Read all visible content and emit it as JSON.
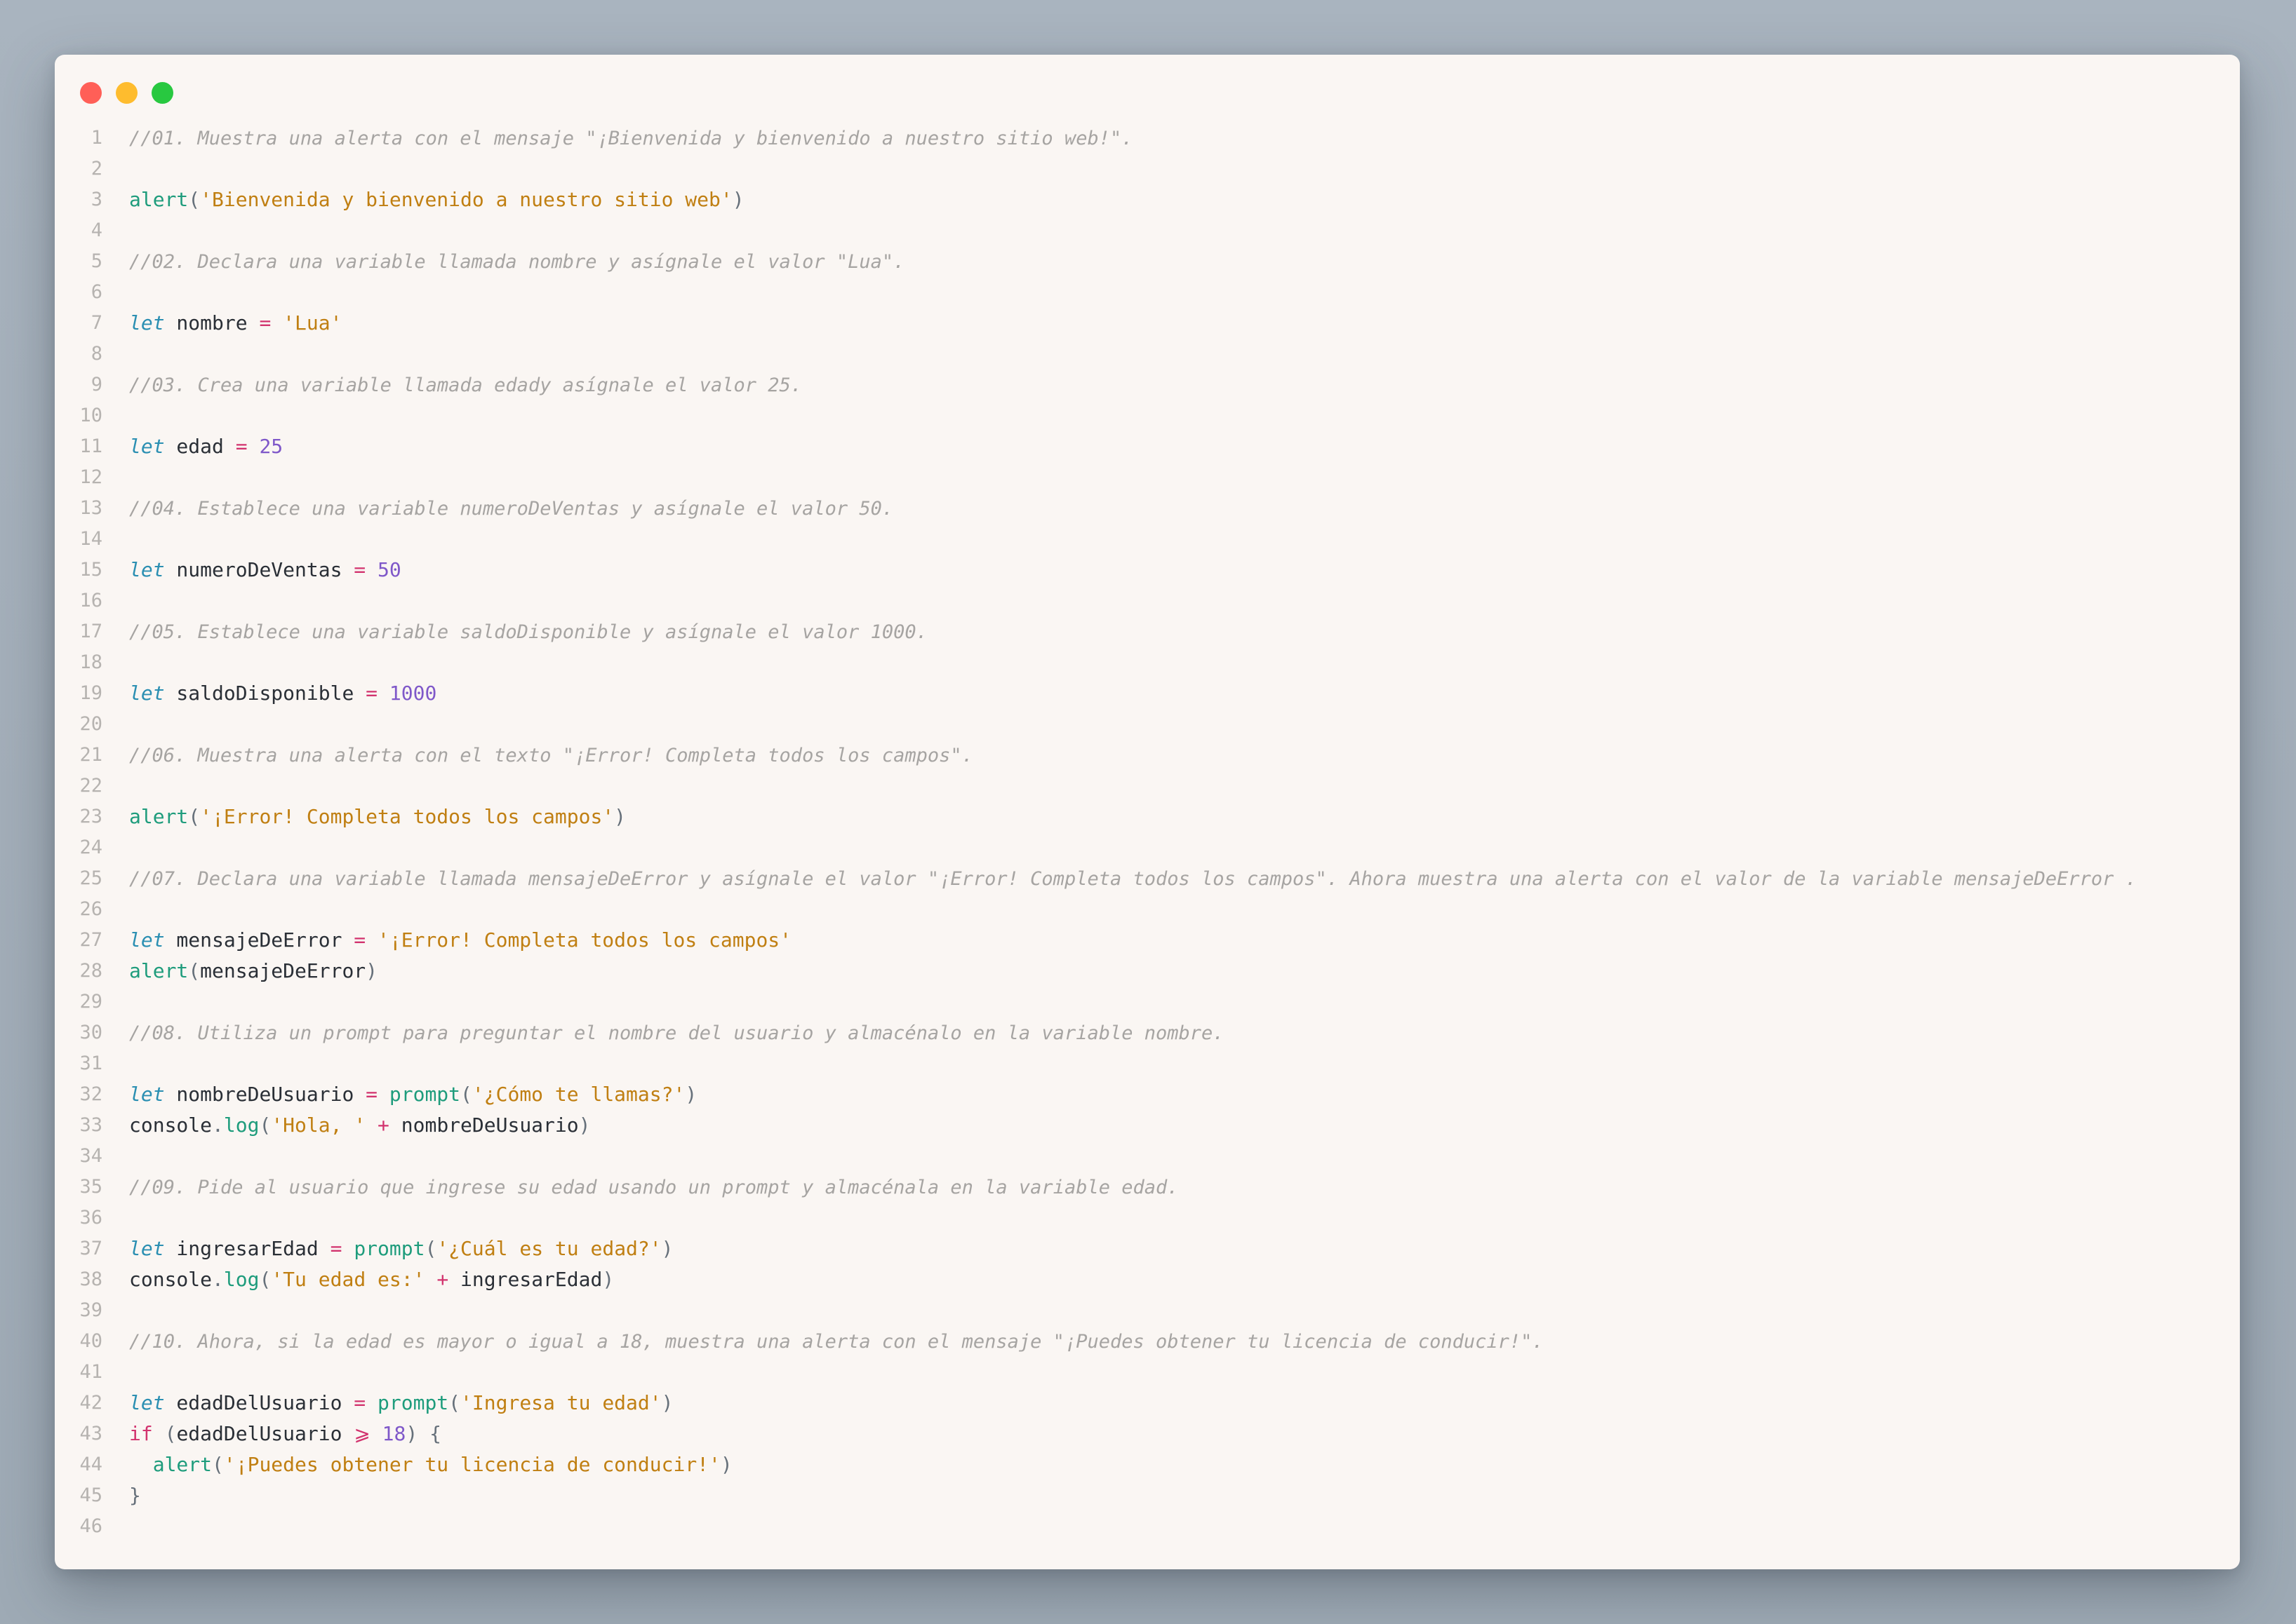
{
  "window": {
    "traffic_lights": [
      {
        "name": "close",
        "color": "#ff5f57"
      },
      {
        "name": "minimize",
        "color": "#febc2e"
      },
      {
        "name": "zoom",
        "color": "#28c840"
      }
    ]
  },
  "colors": {
    "background": "#a6b1bc",
    "editor_bg": "#faf6f3",
    "comment": "#a6a4a2",
    "keyword": "#2b8fb2",
    "if_keyword": "#d2336e",
    "function": "#1e9c7c",
    "string": "#c07f12",
    "number": "#7f58c9",
    "operator": "#d2336e"
  },
  "code": {
    "lines": [
      {
        "n": "1",
        "tokens": [
          {
            "c": "comment",
            "t": "//01. Muestra una alerta con el mensaje \"¡Bienvenida y bienvenido a nuestro sitio web!\"."
          }
        ]
      },
      {
        "n": "2",
        "tokens": []
      },
      {
        "n": "3",
        "tokens": [
          {
            "c": "fn",
            "t": "alert"
          },
          {
            "c": "pun",
            "t": "("
          },
          {
            "c": "str",
            "t": "'Bienvenida y bienvenido a nuestro sitio web'"
          },
          {
            "c": "pun",
            "t": ")"
          }
        ]
      },
      {
        "n": "4",
        "tokens": []
      },
      {
        "n": "5",
        "tokens": [
          {
            "c": "comment",
            "t": "//02. Declara una variable llamada nombre y asígnale el valor \"Lua\"."
          }
        ]
      },
      {
        "n": "6",
        "tokens": []
      },
      {
        "n": "7",
        "tokens": [
          {
            "c": "kw",
            "t": "let"
          },
          {
            "c": "id",
            "t": " nombre "
          },
          {
            "c": "op",
            "t": "="
          },
          {
            "c": "id",
            "t": " "
          },
          {
            "c": "str",
            "t": "'Lua'"
          }
        ]
      },
      {
        "n": "8",
        "tokens": []
      },
      {
        "n": "9",
        "tokens": [
          {
            "c": "comment",
            "t": "//03. Crea una variable llamada edady asígnale el valor 25."
          }
        ]
      },
      {
        "n": "10",
        "tokens": []
      },
      {
        "n": "11",
        "tokens": [
          {
            "c": "kw",
            "t": "let"
          },
          {
            "c": "id",
            "t": " edad "
          },
          {
            "c": "op",
            "t": "="
          },
          {
            "c": "id",
            "t": " "
          },
          {
            "c": "num",
            "t": "25"
          }
        ]
      },
      {
        "n": "12",
        "tokens": []
      },
      {
        "n": "13",
        "tokens": [
          {
            "c": "comment",
            "t": "//04. Establece una variable numeroDeVentas y asígnale el valor 50."
          }
        ]
      },
      {
        "n": "14",
        "tokens": []
      },
      {
        "n": "15",
        "tokens": [
          {
            "c": "kw",
            "t": "let"
          },
          {
            "c": "id",
            "t": " numeroDeVentas "
          },
          {
            "c": "op",
            "t": "="
          },
          {
            "c": "id",
            "t": " "
          },
          {
            "c": "num",
            "t": "50"
          }
        ]
      },
      {
        "n": "16",
        "tokens": []
      },
      {
        "n": "17",
        "tokens": [
          {
            "c": "comment",
            "t": "//05. Establece una variable saldoDisponible y asígnale el valor 1000."
          }
        ]
      },
      {
        "n": "18",
        "tokens": []
      },
      {
        "n": "19",
        "tokens": [
          {
            "c": "kw",
            "t": "let"
          },
          {
            "c": "id",
            "t": " saldoDisponible "
          },
          {
            "c": "op",
            "t": "="
          },
          {
            "c": "id",
            "t": " "
          },
          {
            "c": "num",
            "t": "1000"
          }
        ]
      },
      {
        "n": "20",
        "tokens": []
      },
      {
        "n": "21",
        "tokens": [
          {
            "c": "comment",
            "t": "//06. Muestra una alerta con el texto \"¡Error! Completa todos los campos\"."
          }
        ]
      },
      {
        "n": "22",
        "tokens": []
      },
      {
        "n": "23",
        "tokens": [
          {
            "c": "fn",
            "t": "alert"
          },
          {
            "c": "pun",
            "t": "("
          },
          {
            "c": "str",
            "t": "'¡Error! Completa todos los campos'"
          },
          {
            "c": "pun",
            "t": ")"
          }
        ]
      },
      {
        "n": "24",
        "tokens": []
      },
      {
        "n": "25",
        "tokens": [
          {
            "c": "comment",
            "t": "//07. Declara una variable llamada mensajeDeError y asígnale el valor \"¡Error! Completa todos los campos\". Ahora muestra una alerta con el valor de la variable mensajeDeError ."
          }
        ]
      },
      {
        "n": "26",
        "tokens": []
      },
      {
        "n": "27",
        "tokens": [
          {
            "c": "kw",
            "t": "let"
          },
          {
            "c": "id",
            "t": " mensajeDeError "
          },
          {
            "c": "op",
            "t": "="
          },
          {
            "c": "id",
            "t": " "
          },
          {
            "c": "str",
            "t": "'¡Error! Completa todos los campos'"
          }
        ]
      },
      {
        "n": "28",
        "tokens": [
          {
            "c": "fn",
            "t": "alert"
          },
          {
            "c": "pun",
            "t": "("
          },
          {
            "c": "id",
            "t": "mensajeDeError"
          },
          {
            "c": "pun",
            "t": ")"
          }
        ]
      },
      {
        "n": "29",
        "tokens": []
      },
      {
        "n": "30",
        "tokens": [
          {
            "c": "comment",
            "t": "//08. Utiliza un prompt para preguntar el nombre del usuario y almacénalo en la variable nombre."
          }
        ]
      },
      {
        "n": "31",
        "tokens": []
      },
      {
        "n": "32",
        "tokens": [
          {
            "c": "kw",
            "t": "let"
          },
          {
            "c": "id",
            "t": " nombreDeUsuario "
          },
          {
            "c": "op",
            "t": "="
          },
          {
            "c": "id",
            "t": " "
          },
          {
            "c": "fn",
            "t": "prompt"
          },
          {
            "c": "pun",
            "t": "("
          },
          {
            "c": "str",
            "t": "'¿Cómo te llamas?'"
          },
          {
            "c": "pun",
            "t": ")"
          }
        ]
      },
      {
        "n": "33",
        "tokens": [
          {
            "c": "id",
            "t": "console"
          },
          {
            "c": "pun",
            "t": "."
          },
          {
            "c": "fn",
            "t": "log"
          },
          {
            "c": "pun",
            "t": "("
          },
          {
            "c": "str",
            "t": "'Hola, '"
          },
          {
            "c": "id",
            "t": " "
          },
          {
            "c": "op",
            "t": "+"
          },
          {
            "c": "id",
            "t": " nombreDeUsuario"
          },
          {
            "c": "pun",
            "t": ")"
          }
        ]
      },
      {
        "n": "34",
        "tokens": []
      },
      {
        "n": "35",
        "tokens": [
          {
            "c": "comment",
            "t": "//09. Pide al usuario que ingrese su edad usando un prompt y almacénala en la variable edad."
          }
        ]
      },
      {
        "n": "36",
        "tokens": []
      },
      {
        "n": "37",
        "tokens": [
          {
            "c": "kw",
            "t": "let"
          },
          {
            "c": "id",
            "t": " ingresarEdad "
          },
          {
            "c": "op",
            "t": "="
          },
          {
            "c": "id",
            "t": " "
          },
          {
            "c": "fn",
            "t": "prompt"
          },
          {
            "c": "pun",
            "t": "("
          },
          {
            "c": "str",
            "t": "'¿Cuál es tu edad?'"
          },
          {
            "c": "pun",
            "t": ")"
          }
        ]
      },
      {
        "n": "38",
        "tokens": [
          {
            "c": "id",
            "t": "console"
          },
          {
            "c": "pun",
            "t": "."
          },
          {
            "c": "fn",
            "t": "log"
          },
          {
            "c": "pun",
            "t": "("
          },
          {
            "c": "str",
            "t": "'Tu edad es:'"
          },
          {
            "c": "id",
            "t": " "
          },
          {
            "c": "op",
            "t": "+"
          },
          {
            "c": "id",
            "t": " ingresarEdad"
          },
          {
            "c": "pun",
            "t": ")"
          }
        ]
      },
      {
        "n": "39",
        "tokens": []
      },
      {
        "n": "40",
        "tokens": [
          {
            "c": "comment",
            "t": "//10. Ahora, si la edad es mayor o igual a 18, muestra una alerta con el mensaje \"¡Puedes obtener tu licencia de conducir!\"."
          }
        ]
      },
      {
        "n": "41",
        "tokens": []
      },
      {
        "n": "42",
        "tokens": [
          {
            "c": "kw",
            "t": "let"
          },
          {
            "c": "id",
            "t": " edadDelUsuario "
          },
          {
            "c": "op",
            "t": "="
          },
          {
            "c": "id",
            "t": " "
          },
          {
            "c": "fn",
            "t": "prompt"
          },
          {
            "c": "pun",
            "t": "("
          },
          {
            "c": "str",
            "t": "'Ingresa tu edad'"
          },
          {
            "c": "pun",
            "t": ")"
          }
        ]
      },
      {
        "n": "43",
        "tokens": [
          {
            "c": "if",
            "t": "if"
          },
          {
            "c": "id",
            "t": " "
          },
          {
            "c": "pun",
            "t": "("
          },
          {
            "c": "id",
            "t": "edadDelUsuario "
          },
          {
            "c": "op",
            "t": "⩾"
          },
          {
            "c": "id",
            "t": " "
          },
          {
            "c": "num",
            "t": "18"
          },
          {
            "c": "pun",
            "t": ")"
          },
          {
            "c": "id",
            "t": " "
          },
          {
            "c": "pun",
            "t": "{"
          }
        ]
      },
      {
        "n": "44",
        "tokens": [
          {
            "c": "id",
            "t": "  "
          },
          {
            "c": "fn",
            "t": "alert"
          },
          {
            "c": "pun",
            "t": "("
          },
          {
            "c": "str",
            "t": "'¡Puedes obtener tu licencia de conducir!'"
          },
          {
            "c": "pun",
            "t": ")"
          }
        ]
      },
      {
        "n": "45",
        "tokens": [
          {
            "c": "pun",
            "t": "}"
          }
        ]
      },
      {
        "n": "46",
        "tokens": []
      }
    ]
  }
}
